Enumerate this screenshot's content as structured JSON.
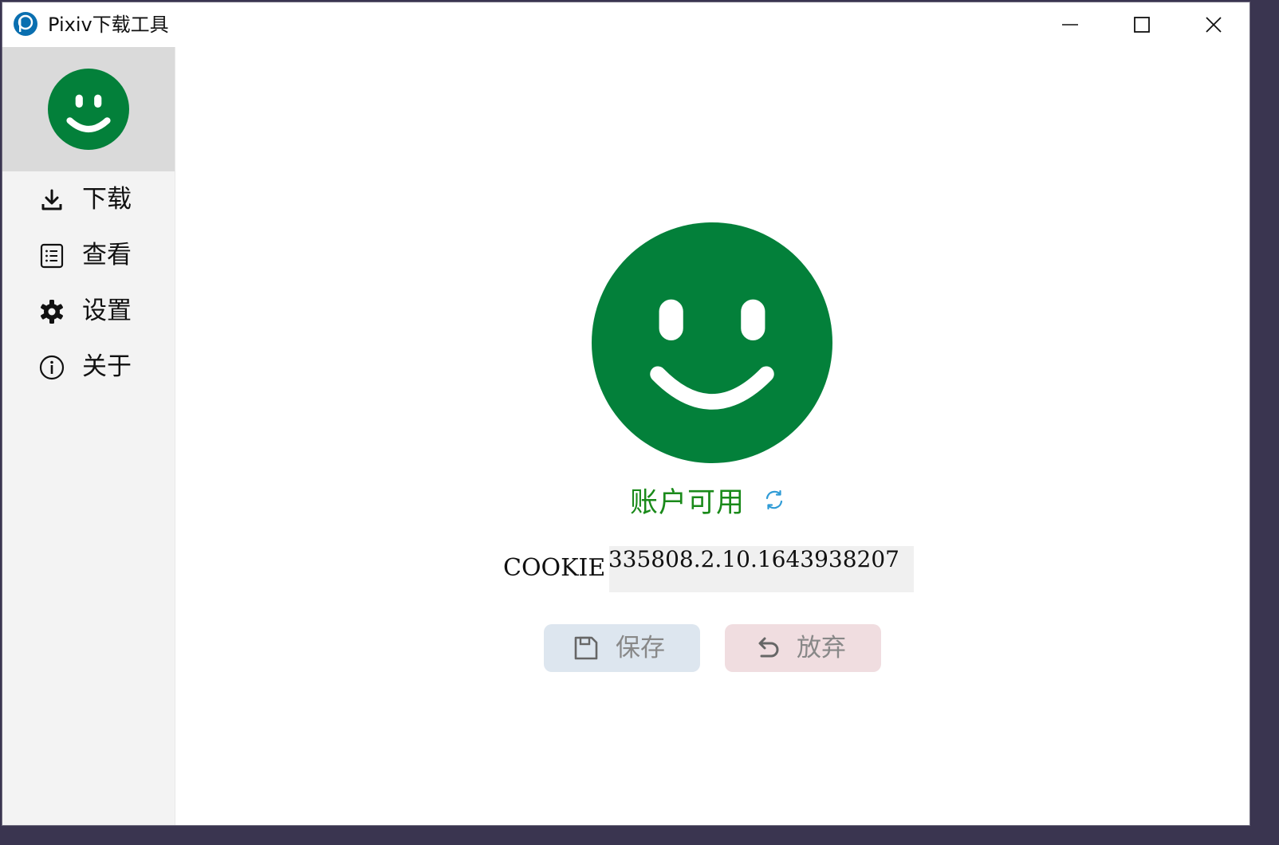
{
  "window": {
    "title": "Pixiv下载工具"
  },
  "sidebar": {
    "avatar": {
      "icon": "smiley-face-icon",
      "color": "#03803a"
    },
    "items": [
      {
        "label": "下载",
        "icon": "download-icon"
      },
      {
        "label": "查看",
        "icon": "list-icon"
      },
      {
        "label": "设置",
        "icon": "gear-icon"
      },
      {
        "label": "关于",
        "icon": "info-icon"
      }
    ]
  },
  "main": {
    "status_icon": "smiley-face-icon",
    "status_icon_color": "#03803a",
    "status_text": "账户可用",
    "status_color": "#1a8a1a",
    "refresh_icon": "refresh-icon",
    "cookie_label": "COOKIE",
    "cookie_value": "335808.2.10.1643938207",
    "save_label": "保存",
    "discard_label": "放弃"
  },
  "colors": {
    "accent_blue": "#2e9bd6",
    "save_bg": "#dde6ef",
    "discard_bg": "#f0dde0"
  }
}
